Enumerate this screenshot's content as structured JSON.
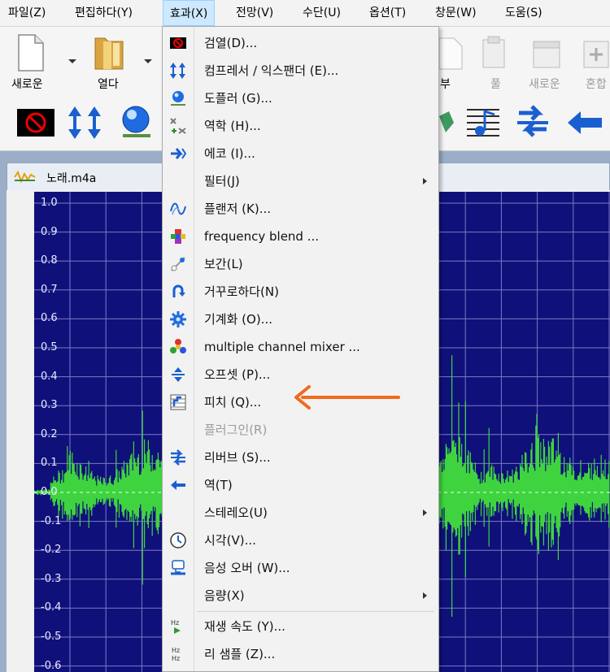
{
  "menubar": {
    "items": [
      {
        "label": "파일(Z)"
      },
      {
        "label": "편집하다(Y)"
      },
      {
        "label": "효과(X)"
      },
      {
        "label": "전망(V)"
      },
      {
        "label": "수단(U)"
      },
      {
        "label": "옵션(T)"
      },
      {
        "label": "창문(W)"
      },
      {
        "label": "도움(S)"
      }
    ]
  },
  "toolbar": {
    "new_label": "새로운",
    "open_label": "열다",
    "right_labels": [
      "부",
      "풀",
      "새로운",
      "혼합"
    ]
  },
  "document": {
    "title": "노래.m4a"
  },
  "waveform": {
    "y_ticks": [
      "1.0",
      "0.9",
      "0.8",
      "0.7",
      "0.6",
      "0.5",
      "0.4",
      "0.3",
      "0.2",
      "0.1",
      "0.0",
      "-0.1",
      "-0.2",
      "-0.3",
      "-0.4",
      "-0.5",
      "-0.6"
    ]
  },
  "effects_menu": {
    "items": [
      {
        "label": "검열(D)...",
        "icon": "censor-icon"
      },
      {
        "label": "컴프레서 / 익스팬더 (E)...",
        "icon": "compressor-icon"
      },
      {
        "label": "도플러 (G)...",
        "icon": "doppler-icon"
      },
      {
        "label": "역학 (H)...",
        "icon": "dynamics-icon"
      },
      {
        "label": "에코 (I)...",
        "icon": "echo-icon"
      },
      {
        "label": "필터(J)",
        "icon": "",
        "submenu": true
      },
      {
        "label": "플랜저 (K)...",
        "icon": "flanger-icon"
      },
      {
        "label": "frequency blend ...",
        "icon": "frequency-blend-icon"
      },
      {
        "label": "보간(L)",
        "icon": "interpolate-icon"
      },
      {
        "label": "거꾸로하다(N)",
        "icon": "invert-icon"
      },
      {
        "label": "기계화 (O)...",
        "icon": "mechanize-icon"
      },
      {
        "label": "multiple channel mixer ...",
        "icon": "channel-mixer-icon"
      },
      {
        "label": "오프셋 (P)...",
        "icon": "offset-icon"
      },
      {
        "label": "피치 (Q)...",
        "icon": "pitch-icon"
      },
      {
        "label": "플러그인(R)",
        "icon": "",
        "disabled": true
      },
      {
        "label": "리버브 (S)...",
        "icon": "reverb-icon"
      },
      {
        "label": "역(T)",
        "icon": "reverse-icon"
      },
      {
        "label": "스테레오(U)",
        "icon": "",
        "submenu": true
      },
      {
        "label": "시각(V)...",
        "icon": "clock-icon"
      },
      {
        "label": "음성 오버 (W)...",
        "icon": "voice-over-icon"
      },
      {
        "label": "음량(X)",
        "icon": "",
        "submenu": true
      },
      {
        "label": "재생 속도 (Y)...",
        "icon": "playback-speed-icon"
      },
      {
        "label": "리 샘플 (Z)...",
        "icon": "resample-icon"
      }
    ]
  },
  "colors": {
    "waveform": "#3fd43f",
    "plot_bg": "#10107a",
    "arrow": "#f06a1e",
    "menu_highlight": "#cde8ff"
  }
}
